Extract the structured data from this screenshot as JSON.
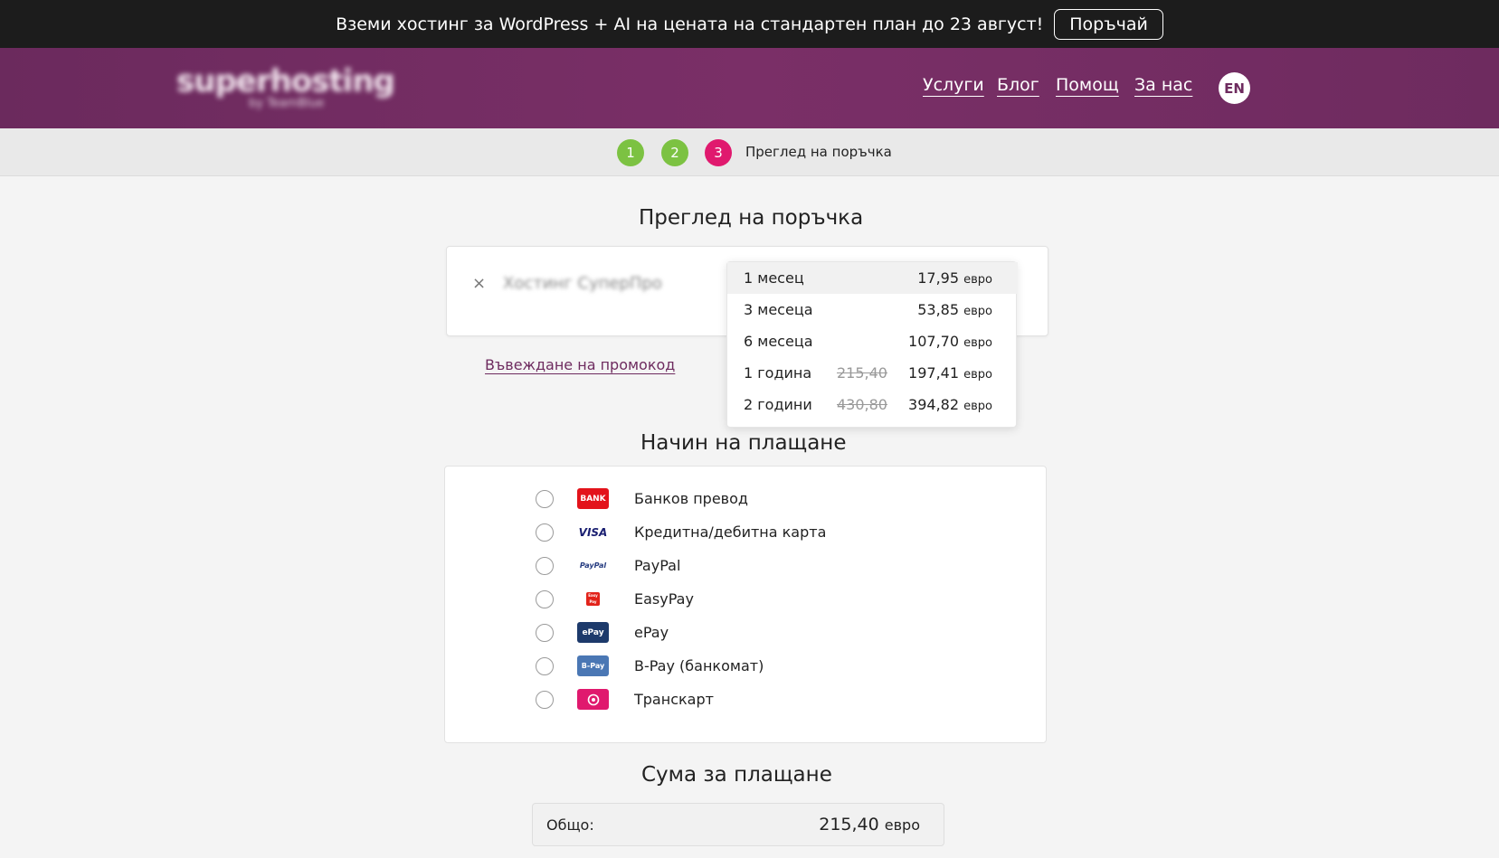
{
  "promo_bar": {
    "text": "Вземи хостинг за WordPress + AI на цената на стандартен план до 23 август!",
    "button_label": "Поръчай"
  },
  "header": {
    "logo_text": "superhosting",
    "logo_sub": "by TeamBlue",
    "nav": [
      {
        "label": "Услуги"
      },
      {
        "label": "Блог"
      },
      {
        "label": "Помощ"
      },
      {
        "label": "За нас"
      }
    ],
    "lang_label": "EN"
  },
  "steps": {
    "items": [
      {
        "number": "1",
        "status": "done"
      },
      {
        "number": "2",
        "status": "done"
      },
      {
        "number": "3",
        "status": "active"
      }
    ],
    "current_label": "Преглед на поръчка"
  },
  "order_review": {
    "title": "Преглед на поръчка",
    "remove_icon": "×",
    "product_name": "Хостинг СуперПро",
    "promo_link": "Въвеждане на промокод",
    "periods": [
      {
        "label": "1 месец",
        "old_price": "",
        "price": "17,95",
        "currency": "евро",
        "selected": true
      },
      {
        "label": "3 месеца",
        "old_price": "",
        "price": "53,85",
        "currency": "евро",
        "selected": false
      },
      {
        "label": "6 месеца",
        "old_price": "",
        "price": "107,70",
        "currency": "евро",
        "selected": false
      },
      {
        "label": "1 година",
        "old_price": "215,40",
        "price": "197,41",
        "currency": "евро",
        "selected": false
      },
      {
        "label": "2 години",
        "old_price": "430,80",
        "price": "394,82",
        "currency": "евро",
        "selected": false
      }
    ]
  },
  "payment": {
    "title": "Начин на плащане",
    "methods": [
      {
        "label": "Банков превод",
        "icon_text": "BANK",
        "icon": "bank-icon"
      },
      {
        "label": "Кредитна/дебитна карта",
        "icon_text": "VISA",
        "icon": "visa-icon"
      },
      {
        "label": "PayPal",
        "icon_text": "PayPal",
        "icon": "paypal-icon"
      },
      {
        "label": "EasyPay",
        "icon_text": "Easy Pay",
        "icon": "easypay-icon"
      },
      {
        "label": "ePay",
        "icon_text": "ePay",
        "icon": "epay-icon"
      },
      {
        "label": "B-Pay (банкомат)",
        "icon_text": "B-Pay",
        "icon": "bpay-icon"
      },
      {
        "label": "Транскарт",
        "icon_text": "",
        "icon": "transcard-icon"
      }
    ]
  },
  "summary": {
    "title": "Сума за плащане",
    "total_label": "Общо:",
    "total_value": "215,40",
    "currency": "евро"
  },
  "colors": {
    "header_bg": "#7a2f67",
    "step_done": "#7cc242",
    "step_active": "#e0196e",
    "promo_link": "#6e2b5f"
  }
}
